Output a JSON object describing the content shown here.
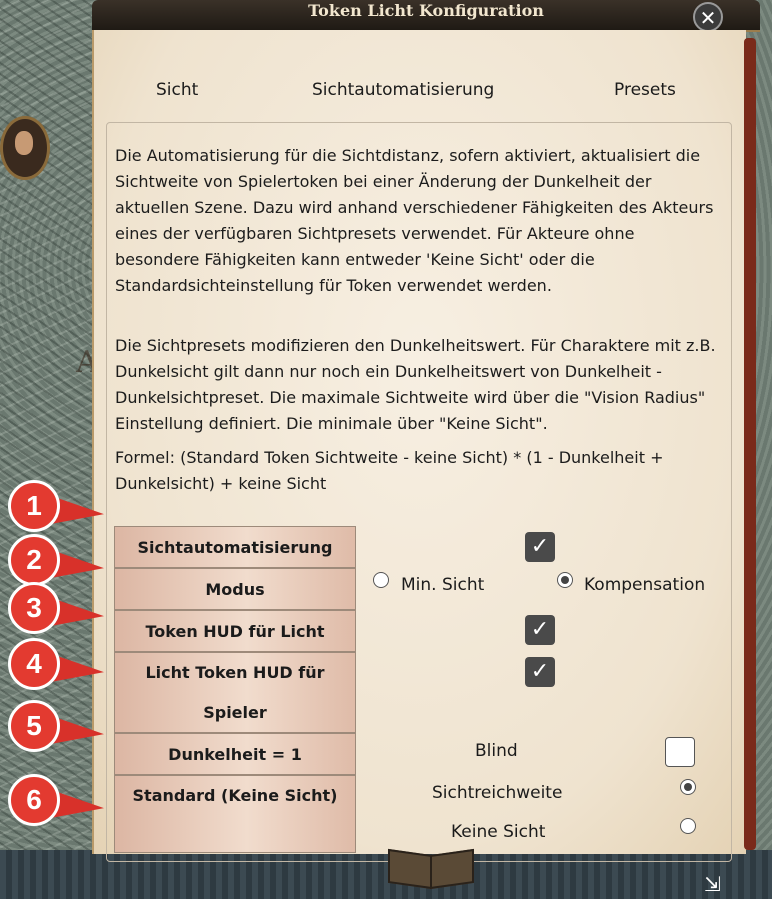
{
  "window": {
    "title": "Token Licht Konfiguration",
    "close_label": "✕"
  },
  "tabs": [
    "Sicht",
    "Sichtautomatisierung",
    "Presets"
  ],
  "description": {
    "p1": "Die Automatisierung für die Sichtdistanz, sofern aktiviert, aktualisiert die Sichtweite von Spielertoken bei einer Änderung der Dunkelheit der aktuellen Szene. Dazu wird anhand verschiedener Fähigkeiten des Akteurs eines der verfügbaren Sichtpresets verwendet. Für Akteure ohne besondere Fähigkeiten kann entweder 'Keine Sicht' oder die Standardsichteinstellung für Token verwendet werden.",
    "p2": "Die Sichtpresets modifizieren den Dunkelheitswert. Für Charaktere mit z.B. Dunkelsicht gilt dann nur noch ein Dunkelheitswert von Dunkelheit - Dunkelsichtpreset. Die maximale Sichtweite wird über die \"Vision Radius\" Einstellung definiert. Die minimale über \"Keine Sicht\".",
    "p3": "Formel: (Standard Token Sichtweite - keine Sicht) * (1 - Dunkelheit + Dunkelsicht) + keine Sicht"
  },
  "settings": {
    "automation": {
      "label": "Sichtautomatisierung",
      "checked": true
    },
    "mode": {
      "label": "Modus",
      "options": [
        "Min. Sicht",
        "Kompensation"
      ],
      "selected": "Kompensation"
    },
    "token_hud": {
      "label": "Token HUD für Licht",
      "checked": true
    },
    "player_hud": {
      "label": "Licht Token HUD für Spieler",
      "checked": true
    },
    "darkness": {
      "label": "Dunkelheit = 1",
      "option": "Blind",
      "checked": false
    },
    "default": {
      "label": "Standard (Keine Sicht)",
      "options": [
        "Sichtreichweite",
        "Keine Sicht"
      ],
      "selected": "Sichtreichweite"
    }
  },
  "markers": [
    "1",
    "2",
    "3",
    "4",
    "5",
    "6"
  ],
  "icons": {
    "checkmark": "✓",
    "resize": "⇲"
  }
}
